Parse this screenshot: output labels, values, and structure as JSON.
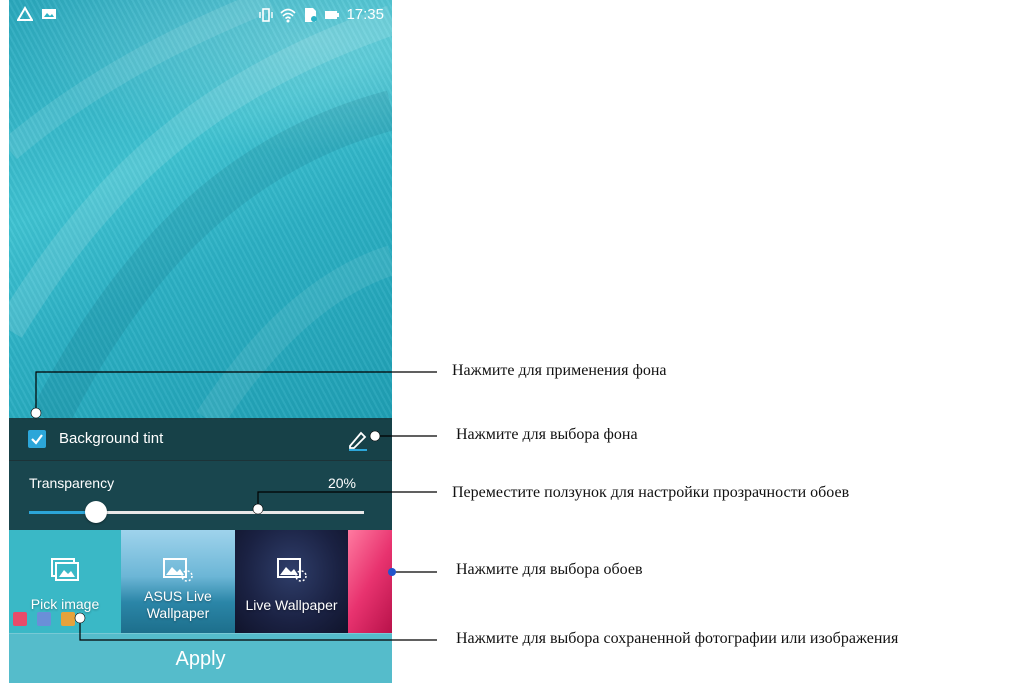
{
  "status_bar": {
    "time": "17:35",
    "left_icons": [
      "drive-icon",
      "image-icon"
    ],
    "right_icons": [
      "vibrate-icon",
      "wifi-icon",
      "sd-card-icon",
      "battery-icon"
    ]
  },
  "background_tint": {
    "label": "Background tint",
    "checked": true,
    "edit_icon": "pen-icon"
  },
  "transparency": {
    "label": "Transparency",
    "value_text": "20%",
    "value": 0.2
  },
  "wallpaper_options": [
    {
      "label": "Pick image",
      "icon": "gallery-icon"
    },
    {
      "label": "ASUS Live Wallpaper",
      "icon": "photo-icon"
    },
    {
      "label": "Live Wallpaper",
      "icon": "photo-icon"
    },
    {
      "label": "",
      "icon": ""
    }
  ],
  "apply_button": {
    "label": "Apply"
  },
  "callouts": [
    "Нажмите для применения фона",
    "Нажмите для выбора фона",
    "Переместите ползунок для настройки прозрачности обоев",
    "Нажмите для выбора обоев",
    "Нажмите для выбора сохраненной фотографии или изображения"
  ],
  "colors": {
    "accent": "#2ca6d9",
    "wallpaper": "#2bb3c6",
    "apply_bar": "#55bccb"
  }
}
